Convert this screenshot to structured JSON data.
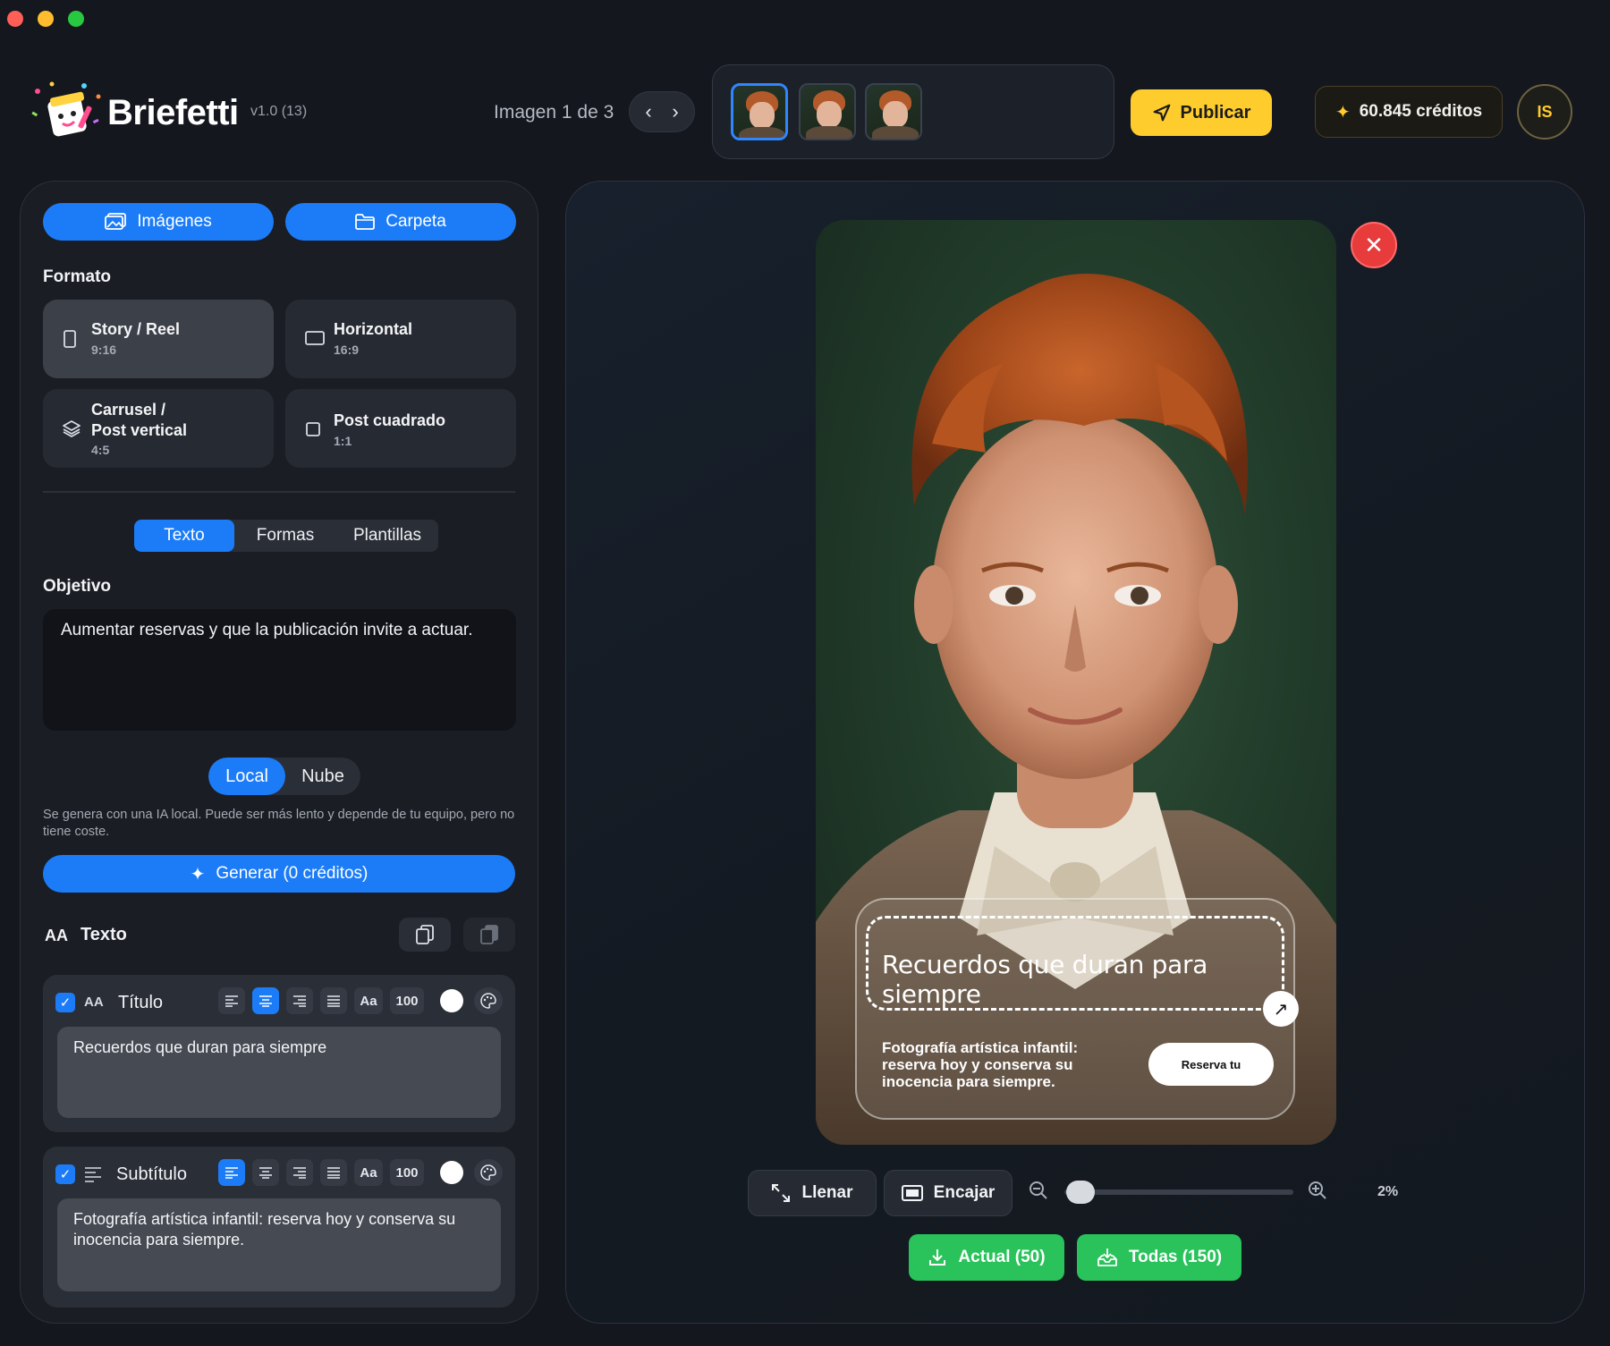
{
  "window": {
    "close_color": "#ff5f57",
    "min_color": "#febc2e",
    "max_color": "#28c840"
  },
  "header": {
    "brand": "Briefetti",
    "version": "v1.0 (13)",
    "image_counter": "Imagen 1 de 3",
    "prev_icon": "chevron-left-icon",
    "next_icon": "chevron-right-icon",
    "thumbnails": [
      "thumbnail-1",
      "thumbnail-2",
      "thumbnail-3"
    ],
    "selected_thumbnail": 0,
    "publish_label": "Publicar",
    "credits_label": "60.845 créditos",
    "avatar_initials": "IS"
  },
  "sidebar": {
    "images_button": "Imágenes",
    "folder_button": "Carpeta",
    "format_label": "Formato",
    "formats": [
      {
        "name": "Story / Reel",
        "ratio": "9:16",
        "selected": true
      },
      {
        "name": "Horizontal",
        "ratio": "16:9",
        "selected": false
      },
      {
        "name": "Carrusel /",
        "name2": "Post vertical",
        "ratio": "4:5",
        "selected": false
      },
      {
        "name": "Post cuadrado",
        "ratio": "1:1",
        "selected": false
      }
    ],
    "tabs": [
      "Texto",
      "Formas",
      "Plantillas"
    ],
    "active_tab": "Texto",
    "objective_label": "Objetivo",
    "objective_text": "Aumentar reservas y que la publicación invite a actuar.",
    "mode_options": [
      "Local",
      "Nube"
    ],
    "active_mode": "Local",
    "mode_note": "Se genera con una IA local. Puede ser más lento y depende de tu equipo, pero no tiene coste.",
    "generate_label": "Generar (0 créditos)",
    "text_section_icon": "AA",
    "text_section_label": "Texto",
    "title_card": {
      "icon": "AA",
      "label": "Título",
      "case_label": "Aa",
      "size_value": "100",
      "text": "Recuerdos que duran para siempre"
    },
    "subtitle_card": {
      "label": "Subtítulo",
      "case_label": "Aa",
      "size_value": "100",
      "text": "Fotografía artística infantil: reserva hoy y conserva su inocencia para siempre."
    }
  },
  "canvas": {
    "overlay_title": "Recuerdos que duran para siempre",
    "overlay_subtitle": "Fotografía artística infantil: reserva hoy y conserva su inocencia para siempre.",
    "overlay_cta": "Reserva tu",
    "fill_label": "Llenar",
    "fit_label": "Encajar",
    "zoom_value": "2%",
    "zoom_level": 0.02,
    "export_current_label": "Actual (50)",
    "export_all_label": "Todas (150)"
  },
  "colors": {
    "accent_blue": "#1c7cf7",
    "publish_yellow": "#ffcc2e",
    "export_green": "#29c25b",
    "close_red": "#e83b3b"
  }
}
